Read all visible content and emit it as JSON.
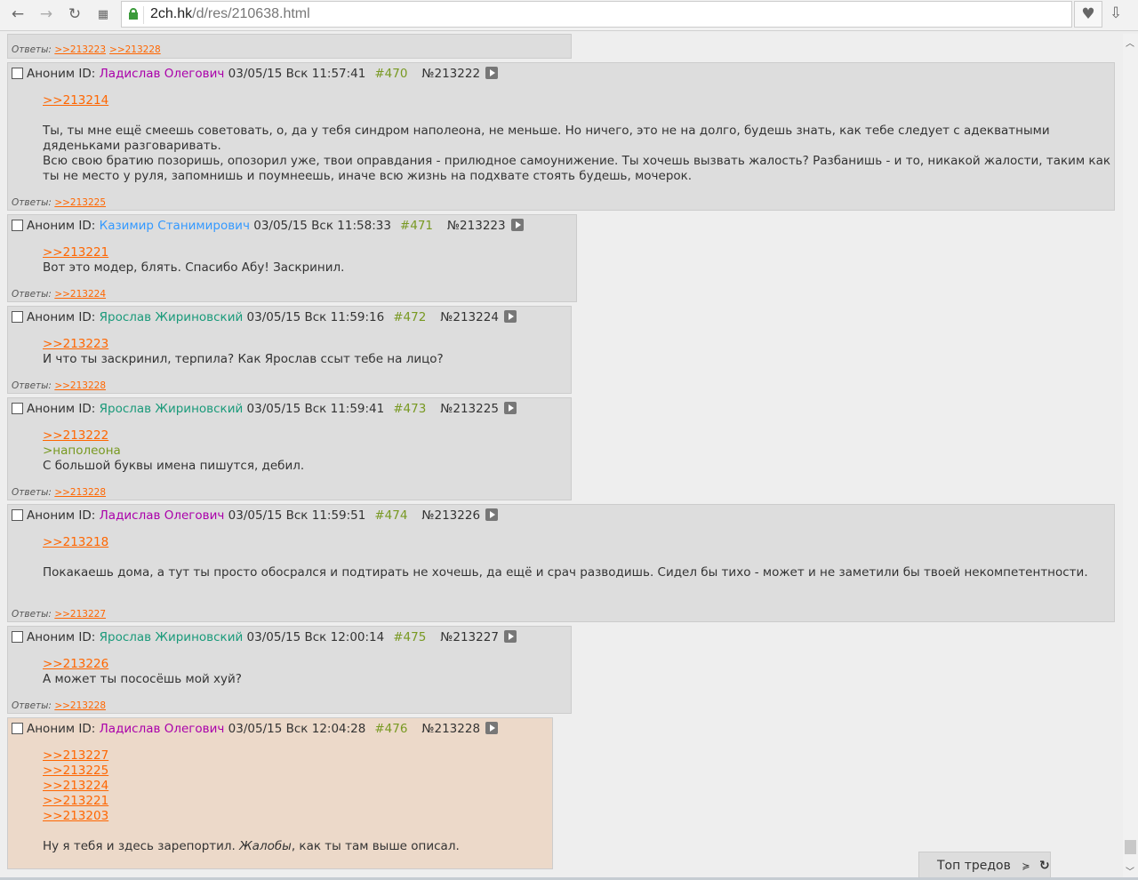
{
  "browser": {
    "url_host": "2ch.hk",
    "url_path": "/d/res/210638.html"
  },
  "top_replies": {
    "label": "Ответы:",
    "links": [
      ">>213223",
      ">>213228"
    ]
  },
  "posts": [
    {
      "anon": "Аноним",
      "id_label": "ID:",
      "name": "Ладислав Олегович",
      "name_color": "#aa00aa",
      "date": "03/05/15 Вск 11:57:41",
      "num": "#470",
      "no": "№213222",
      "width": 1246,
      "body": [
        [
          {
            "l": ">>213214"
          }
        ],
        [],
        [
          {
            "t": "Ты, ты мне ещё смеешь советовать, о, да у тебя синдром наполеона, не меньше. Но ничего, это не на долго, будешь знать, как тебе следует с адекватными дяденьками разговаривать."
          }
        ],
        [
          {
            "t": "Всю свою братию позоришь, опозорил уже, твои оправдания - прилюдное самоунижение. Ты хочешь вызвать жалость? Разбанишь - и то, никакой жалости, таким как ты не место у руля, запомнишь и поумнеешь, иначе всю жизнь на подхвате стоять будешь, мочерок."
          }
        ]
      ],
      "replies": [
        ">>213225"
      ]
    },
    {
      "anon": "Аноним",
      "id_label": "ID:",
      "name": "Казимир Станимирович",
      "name_color": "#3399ff",
      "date": "03/05/15 Вск 11:58:33",
      "num": "#471",
      "no": "№213223",
      "width": 641,
      "body": [
        [
          {
            "l": ">>213221"
          }
        ],
        [
          {
            "t": "Вот это модер, блять. Спасибо Абу! Заскринил."
          }
        ]
      ],
      "replies": [
        ">>213224"
      ]
    },
    {
      "anon": "Аноним",
      "id_label": "ID:",
      "name": "Ярослав Жириновский",
      "name_color": "#1a9a7a",
      "date": "03/05/15 Вск 11:59:16",
      "num": "#472",
      "no": "№213224",
      "width": 635,
      "body": [
        [
          {
            "l": ">>213223"
          }
        ],
        [
          {
            "t": "И что ты заскринил, терпила? Как Ярослав ссыт тебе на лицо?"
          }
        ]
      ],
      "replies": [
        ">>213228"
      ]
    },
    {
      "anon": "Аноним",
      "id_label": "ID:",
      "name": "Ярослав Жириновский",
      "name_color": "#1a9a7a",
      "date": "03/05/15 Вск 11:59:41",
      "num": "#473",
      "no": "№213225",
      "width": 635,
      "body": [
        [
          {
            "l": ">>213222"
          }
        ],
        [
          {
            "q": ">наполеона"
          }
        ],
        [
          {
            "t": "С большой буквы имена пишутся, дебил."
          }
        ]
      ],
      "replies": [
        ">>213228"
      ]
    },
    {
      "anon": "Аноним",
      "id_label": "ID:",
      "name": "Ладислав Олегович",
      "name_color": "#aa00aa",
      "date": "03/05/15 Вск 11:59:51",
      "num": "#474",
      "no": "№213226",
      "width": 1246,
      "body": [
        [
          {
            "l": ">>213218"
          }
        ],
        [],
        [
          {
            "t": "Покакаешь дома, а тут ты просто обосрался и подтирать не хочешь, да ещё и срач разводишь. Сидел бы тихо - может и не заметили бы твоей некомпетентности."
          }
        ]
      ],
      "replies": [
        ">>213227"
      ]
    },
    {
      "anon": "Аноним",
      "id_label": "ID:",
      "name": "Ярослав Жириновский",
      "name_color": "#1a9a7a",
      "date": "03/05/15 Вск 12:00:14",
      "num": "#475",
      "no": "№213227",
      "width": 635,
      "body": [
        [
          {
            "l": ">>213226"
          }
        ],
        [
          {
            "t": "А может ты пососёшь мой хуй?"
          }
        ]
      ],
      "replies": [
        ">>213228"
      ]
    },
    {
      "anon": "Аноним",
      "id_label": "ID:",
      "name": "Ладислав Олегович",
      "name_color": "#aa00aa",
      "date": "03/05/15 Вск 12:04:28",
      "num": "#476",
      "no": "№213228",
      "width": 614,
      "highlight": true,
      "body": [
        [
          {
            "l": ">>213227"
          }
        ],
        [
          {
            "l": ">>213225"
          }
        ],
        [
          {
            "l": ">>213224"
          }
        ],
        [
          {
            "l": ">>213221"
          }
        ],
        [
          {
            "l": ">>213203"
          }
        ],
        [],
        [
          {
            "t": "Ну я тебя и здесь зарепортил. "
          },
          {
            "i": "Жалобы"
          },
          {
            "t": ", как ты там выше описал."
          }
        ]
      ],
      "replies": []
    }
  ],
  "replies_label": "Ответы:",
  "top_threads": {
    "label": "Топ тредов",
    "collapse_icon": "double-chevron-up",
    "refresh_icon": "refresh"
  }
}
